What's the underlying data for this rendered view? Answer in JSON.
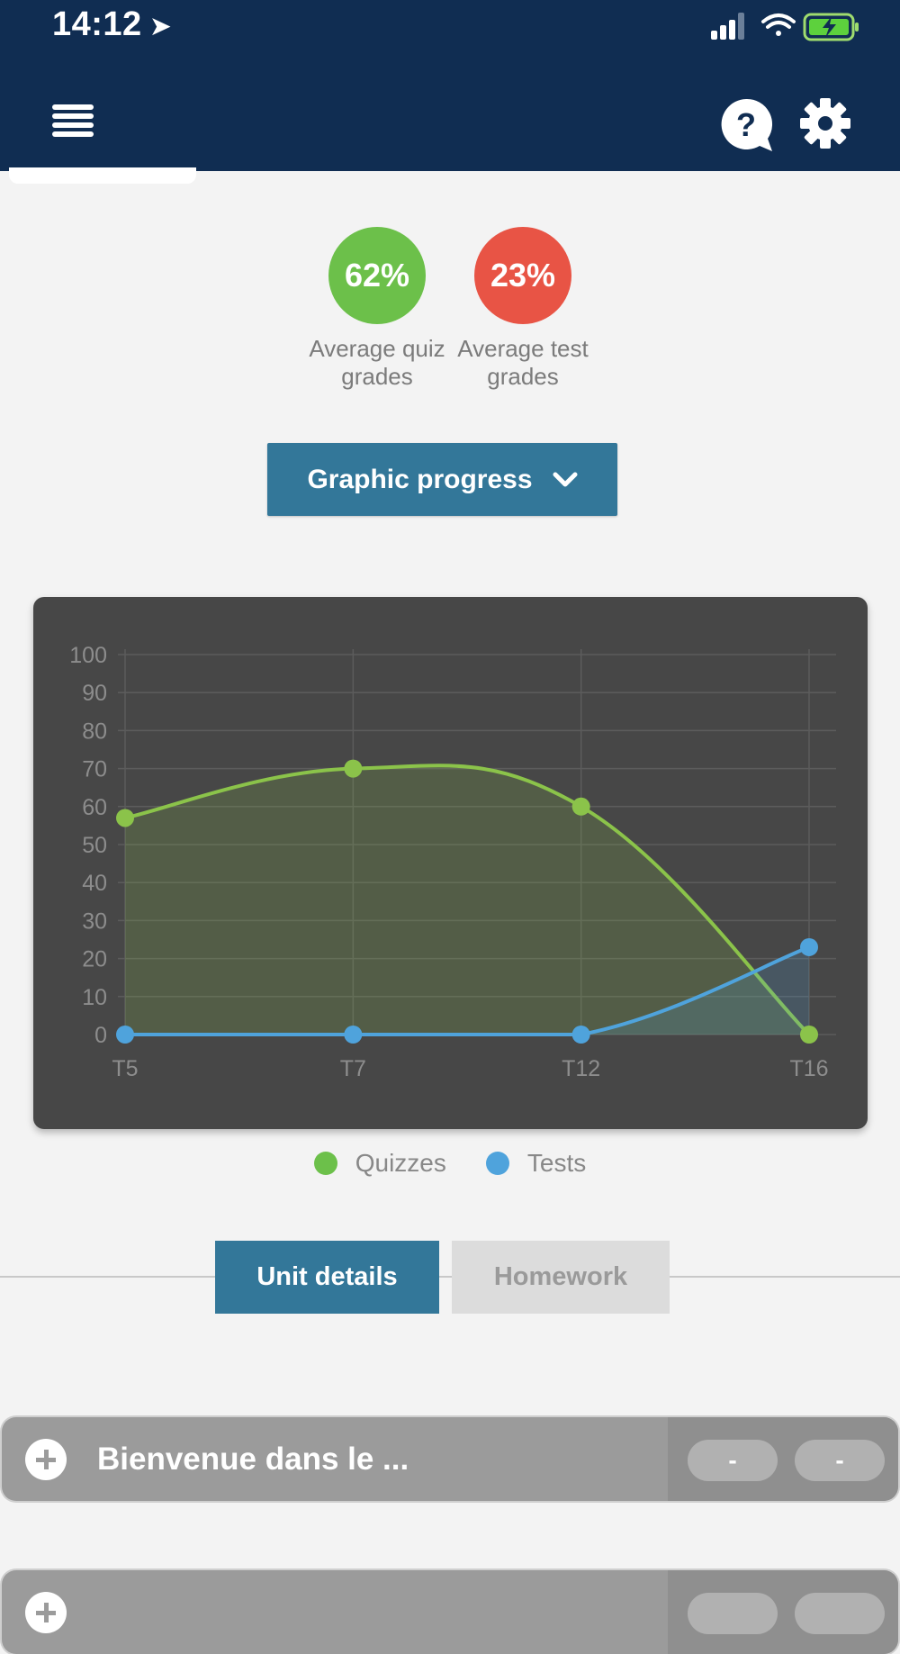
{
  "status_bar": {
    "time": "14:12"
  },
  "grades": {
    "quiz": {
      "value": "62%",
      "label": "Average quiz grades",
      "color": "#6cc04a"
    },
    "test": {
      "value": "23%",
      "label": "Average test grades",
      "color": "#e85445"
    }
  },
  "graphic_button": {
    "label": "Graphic progress"
  },
  "chart_data": {
    "type": "line",
    "categories": [
      "T5",
      "T7",
      "T12",
      "T16"
    ],
    "series": [
      {
        "name": "Quizzes",
        "values": [
          57,
          70,
          60,
          0
        ],
        "color": "#8bc34a"
      },
      {
        "name": "Tests",
        "values": [
          0,
          0,
          0,
          23
        ],
        "color": "#4fa3dc"
      }
    ],
    "ylim": [
      0,
      100
    ],
    "yticks": [
      0,
      10,
      20,
      30,
      40,
      50,
      60,
      70,
      80,
      90,
      100
    ],
    "grid": true,
    "legend": "bottom-center"
  },
  "legend": {
    "quizzes": {
      "label": "Quizzes",
      "color": "#6cc04a"
    },
    "tests": {
      "label": "Tests",
      "color": "#4fa3dc"
    }
  },
  "tabs": {
    "unit_details": "Unit details",
    "homework": "Homework"
  },
  "units": [
    {
      "title": "Bienvenue dans le ...",
      "score_a": "-",
      "score_b": "-"
    },
    {
      "title": "",
      "score_a": "",
      "score_b": ""
    }
  ]
}
